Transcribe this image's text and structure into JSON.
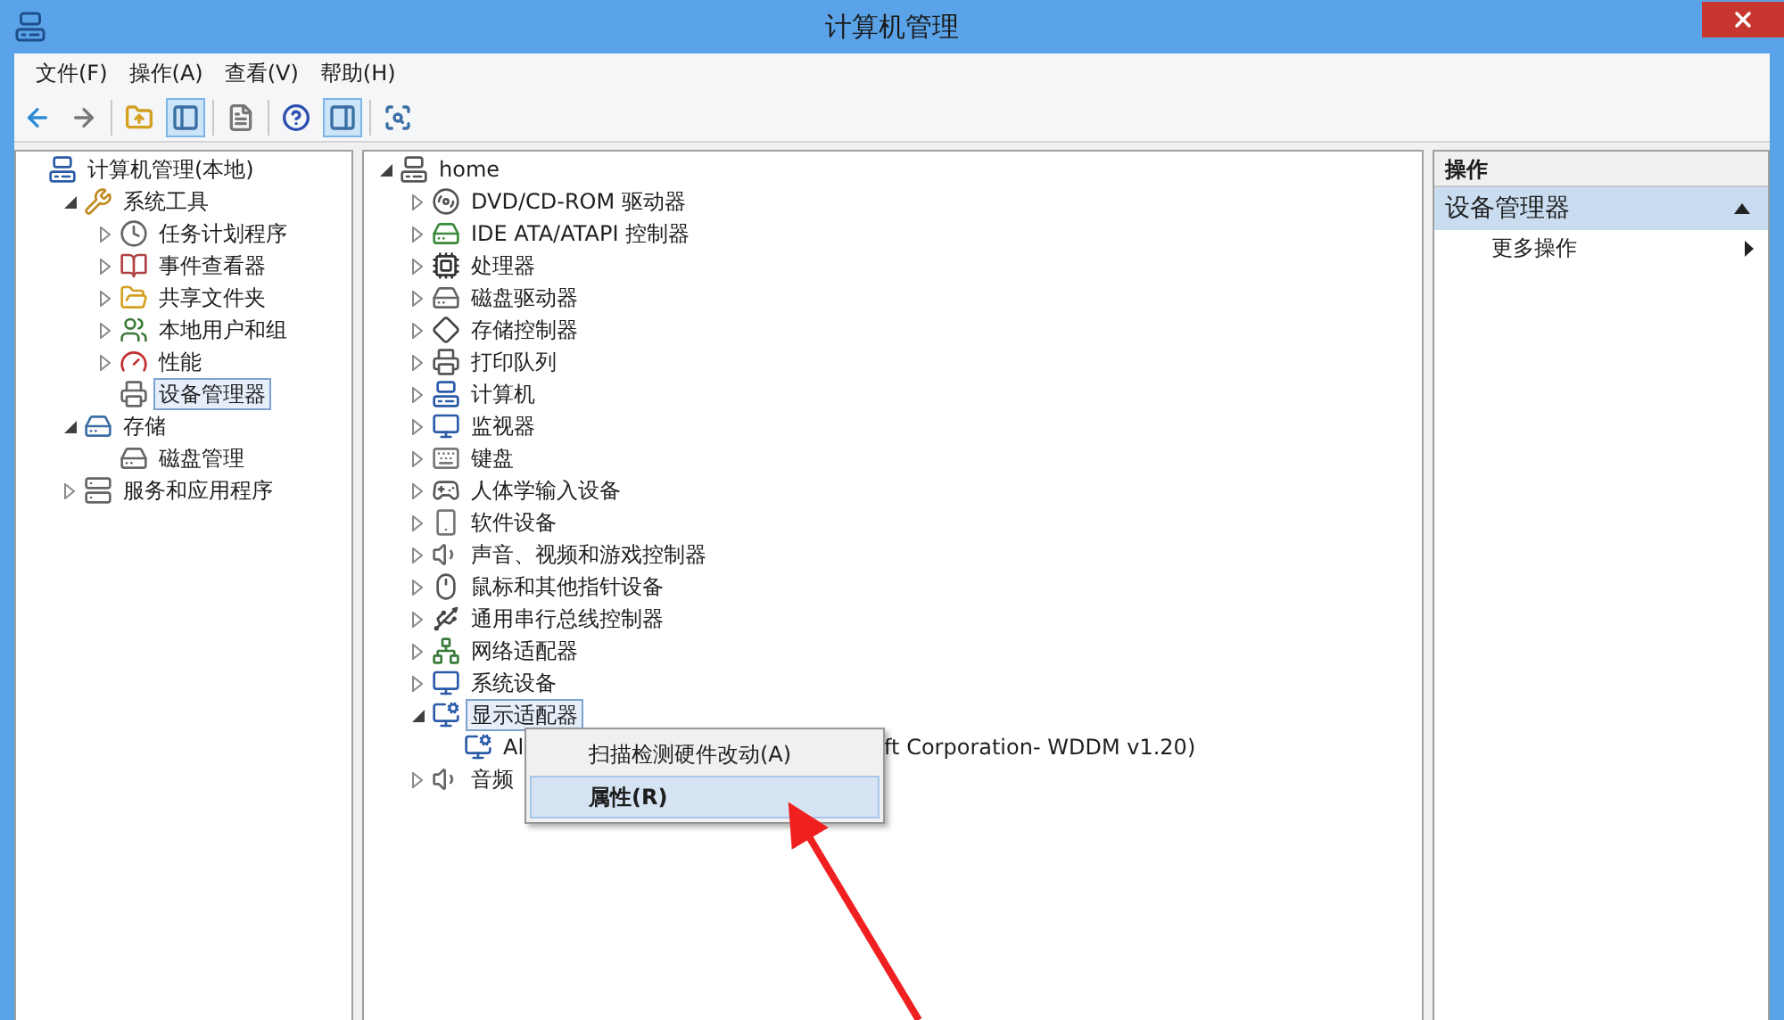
{
  "window": {
    "title": "计算机管理"
  },
  "menu_bar": [
    "文件(F)",
    "操作(A)",
    "查看(V)",
    "帮助(H)"
  ],
  "toolbar": [
    {
      "on": false
    },
    {
      "on": false
    },
    {
      "on": false
    },
    {
      "on": true
    },
    {
      "on": false
    },
    {
      "on": false
    },
    {
      "on": true
    },
    {
      "on": false
    }
  ],
  "nav_tree": [
    {
      "label": "计算机管理(本地)",
      "selected": false,
      "children": [
        {
          "label": "系统工具",
          "expanded": true,
          "selected": false,
          "children": [
            {
              "label": "任务计划程序",
              "expanded": false,
              "selected": false
            },
            {
              "label": "事件查看器",
              "expanded": false,
              "selected": false
            },
            {
              "label": "共享文件夹",
              "expanded": false,
              "selected": false
            },
            {
              "label": "本地用户和组",
              "expanded": false,
              "selected": false
            },
            {
              "label": "性能",
              "expanded": false,
              "selected": false
            },
            {
              "label": "设备管理器",
              "selected": true
            }
          ]
        },
        {
          "label": "存储",
          "expanded": true,
          "selected": false,
          "children": [
            {
              "label": "磁盘管理",
              "selected": false
            }
          ]
        },
        {
          "label": "服务和应用程序",
          "expanded": false,
          "selected": false
        }
      ]
    }
  ],
  "device_tree": [
    {
      "label": "home",
      "expanded": true,
      "selected": false,
      "children": [
        {
          "label": "DVD/CD-ROM 驱动器",
          "expanded": false,
          "selected": false
        },
        {
          "label": "IDE ATA/ATAPI 控制器",
          "expanded": false,
          "selected": false
        },
        {
          "label": "处理器",
          "expanded": false,
          "selected": false
        },
        {
          "label": "磁盘驱动器",
          "expanded": false,
          "selected": false
        },
        {
          "label": "存储控制器",
          "expanded": false,
          "selected": false
        },
        {
          "label": "打印队列",
          "expanded": false,
          "selected": false
        },
        {
          "label": "计算机",
          "expanded": false,
          "selected": false
        },
        {
          "label": "监视器",
          "expanded": false,
          "selected": false
        },
        {
          "label": "键盘",
          "expanded": false,
          "selected": false
        },
        {
          "label": "人体学输入设备",
          "expanded": false,
          "selected": false
        },
        {
          "label": "软件设备",
          "expanded": false,
          "selected": false
        },
        {
          "label": "声音、视频和游戏控制器",
          "expanded": false,
          "selected": false
        },
        {
          "label": "鼠标和其他指针设备",
          "expanded": false,
          "selected": false
        },
        {
          "label": "通用串行总线控制器",
          "expanded": false,
          "selected": false
        },
        {
          "label": "网络适配器",
          "expanded": false,
          "selected": false
        },
        {
          "label": "系统设备",
          "expanded": false,
          "selected": false
        },
        {
          "label": "显示适配器",
          "expanded": true,
          "selected": true,
          "children": [
            {
              "label": "Al",
              "label_tail": "ft Corporation- WDDM v1.20)",
              "selected": false
            }
          ]
        },
        {
          "label": "音频",
          "expanded": false,
          "selected": false
        }
      ]
    }
  ],
  "context_menu": [
    {
      "label": "扫描检测硬件改动(A)",
      "selected": false,
      "default": false
    },
    {
      "label": "属性(R)",
      "selected": true,
      "default": true
    }
  ],
  "actions_pane": {
    "header": "操作",
    "section": {
      "label": "设备管理器",
      "expanded": true
    },
    "items": [
      {
        "label": "更多操作"
      }
    ]
  }
}
